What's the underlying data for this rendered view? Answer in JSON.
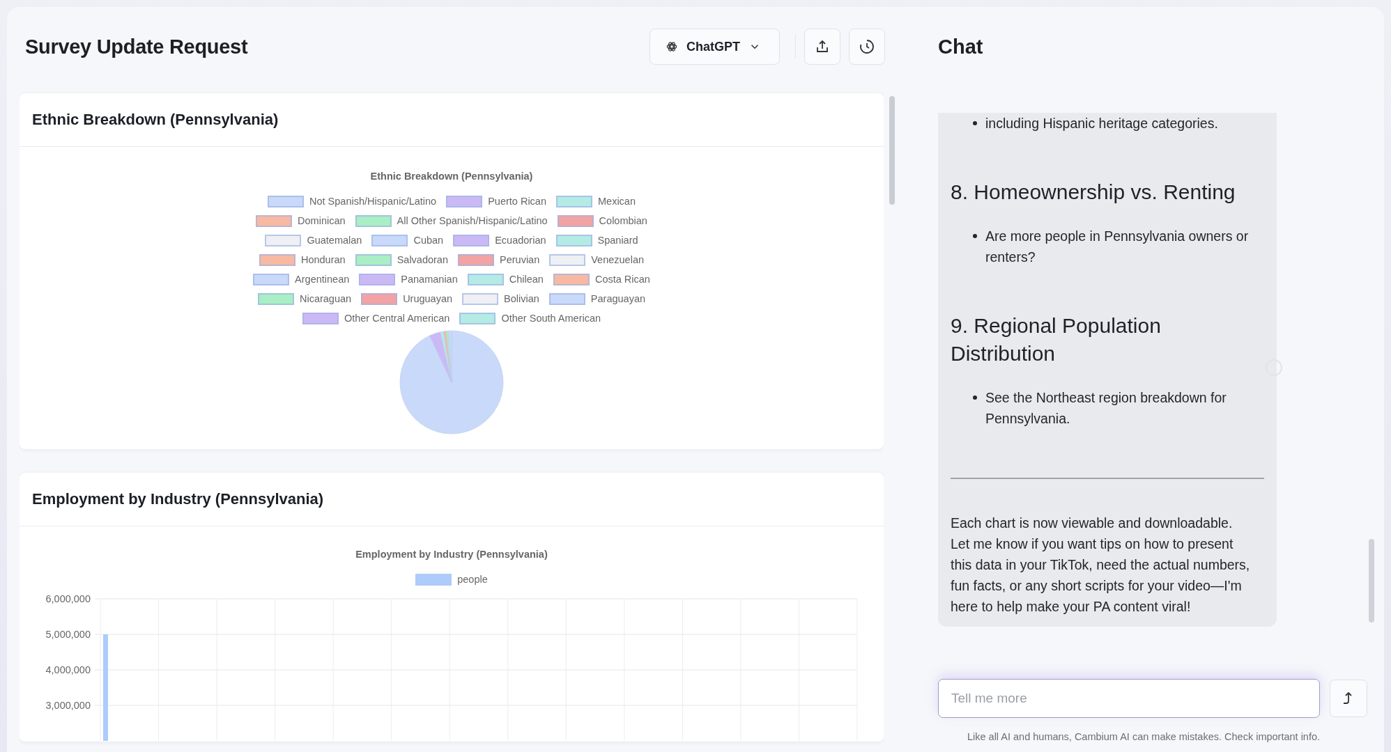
{
  "header": {
    "title": "Survey Update Request",
    "model_button": "ChatGPT"
  },
  "cards": [
    {
      "title": "Ethnic Breakdown (Pennsylvania)",
      "kind": "pie",
      "chart_title": "Ethnic Breakdown (Pennsylvania)",
      "legend": [
        {
          "label": "Not Spanish/Hispanic/Latino",
          "color": "#c9d9f9"
        },
        {
          "label": "Puerto Rican",
          "color": "#cbb9f5"
        },
        {
          "label": "Mexican",
          "color": "#b4ebe4"
        },
        {
          "label": "Dominican",
          "color": "#f8b9a2"
        },
        {
          "label": "All Other Spanish/Hispanic/Latino",
          "color": "#a9eec4"
        },
        {
          "label": "Colombian",
          "color": "#f3a3a3"
        },
        {
          "label": "Guatemalan",
          "color": "#eef0f4"
        },
        {
          "label": "Cuban",
          "color": "#c9d9f9"
        },
        {
          "label": "Ecuadorian",
          "color": "#cbb9f5"
        },
        {
          "label": "Spaniard",
          "color": "#b4ebe4"
        },
        {
          "label": "Honduran",
          "color": "#f8b9a2"
        },
        {
          "label": "Salvadoran",
          "color": "#a9eec4"
        },
        {
          "label": "Peruvian",
          "color": "#f3a3a3"
        },
        {
          "label": "Venezuelan",
          "color": "#eef0f4"
        },
        {
          "label": "Argentinean",
          "color": "#c9d9f9"
        },
        {
          "label": "Panamanian",
          "color": "#cbb9f5"
        },
        {
          "label": "Chilean",
          "color": "#b4ebe4"
        },
        {
          "label": "Costa Rican",
          "color": "#f8b9a2"
        },
        {
          "label": "Nicaraguan",
          "color": "#a9eec4"
        },
        {
          "label": "Uruguayan",
          "color": "#f3a3a3"
        },
        {
          "label": "Bolivian",
          "color": "#eef0f4"
        },
        {
          "label": "Paraguayan",
          "color": "#c9d9f9"
        },
        {
          "label": "Other Central American",
          "color": "#cbb9f5"
        },
        {
          "label": "Other South American",
          "color": "#b4ebe4"
        }
      ]
    },
    {
      "title": "Employment by Industry (Pennsylvania)",
      "kind": "bar",
      "chart_data": {
        "type": "bar",
        "title": "Employment by Industry (Pennsylvania)",
        "legend": "top",
        "grid": true,
        "ylim": [
          2000000,
          6000000
        ],
        "yticks": [
          {
            "value": 3000000,
            "label": "3,000,000"
          },
          {
            "value": 4000000,
            "label": "4,000,000"
          },
          {
            "value": 5000000,
            "label": "5,000,000"
          },
          {
            "value": 6000000,
            "label": "6,000,000"
          }
        ],
        "series": [
          {
            "name": "people",
            "color": "#aecbfa",
            "values": [
              5000000,
              null,
              null,
              null,
              null,
              null,
              null,
              null,
              null,
              null,
              null,
              null,
              null
            ]
          }
        ]
      }
    }
  ],
  "chat": {
    "title": "Chat",
    "messages": [
      {
        "kind": "bullet",
        "text": "including Hispanic heritage categories."
      },
      {
        "kind": "heading",
        "text": "8. Homeownership vs. Renting"
      },
      {
        "kind": "bullet",
        "text": "Are more people in Pennsylvania owners or renters?"
      },
      {
        "kind": "heading",
        "text": "9. Regional Population Distribution"
      },
      {
        "kind": "bullet",
        "text": "See the Northeast region breakdown for Pennsylvania."
      },
      {
        "kind": "rule"
      },
      {
        "kind": "paragraph",
        "text": "Each chart is now viewable and downloadable. Let me know if you want tips on how to present this data in your TikTok, need the actual numbers, fun facts, or any short scripts for your video—I'm here to help make your PA content viral!"
      }
    ],
    "input": {
      "placeholder": "Tell me more"
    },
    "disclaimer": "Like all AI and humans, Cambium AI can make mistakes. Check important info."
  }
}
